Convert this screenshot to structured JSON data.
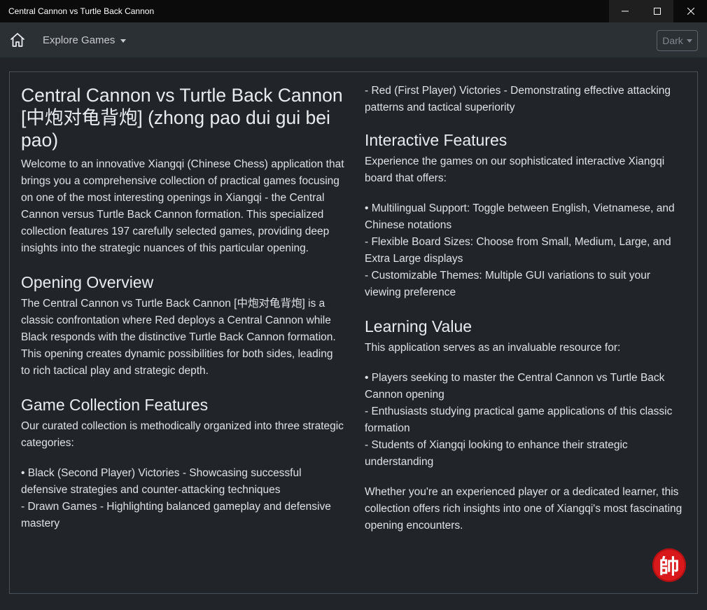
{
  "window": {
    "title": "Central Cannon vs Turtle Back Cannon",
    "minimize_icon": "minimize-icon",
    "maximize_icon": "maximize-icon",
    "close_icon": "close-icon"
  },
  "navbar": {
    "home_icon": "home-icon",
    "explore_label": "Explore Games",
    "theme_label": "Dark"
  },
  "left": {
    "title": "Central Cannon vs Turtle Back Cannon [中炮对龟背炮] (zhong pao dui gui bei pao)",
    "intro": "Welcome to an innovative Xiangqi (Chinese Chess) application that brings you a comprehensive collection of practical games focusing on one of the most interesting openings in Xiangqi - the Central Cannon versus Turtle Back Cannon formation. This specialized collection features 197 carefully selected games, providing deep insights into the strategic nuances of this particular opening.",
    "overview_heading": "Opening Overview",
    "overview_text": "The Central Cannon vs Turtle Back Cannon [中炮对龟背炮] is a classic confrontation where Red deploys a Central Cannon while Black responds with the distinctive Turtle Back Cannon formation. This opening creates dynamic possibilities for both sides, leading to rich tactical play and strategic depth.",
    "collection_heading": "Game Collection Features",
    "collection_intro": "Our curated collection is methodically organized into three strategic categories:",
    "cat_black": "• Black (Second Player) Victories - Showcasing successful defensive strategies and counter-attacking techniques",
    "cat_drawn": "- Drawn Games - Highlighting balanced gameplay and defensive mastery"
  },
  "right": {
    "cat_red": "- Red (First Player) Victories - Demonstrating effective attacking patterns and tactical superiority",
    "interactive_heading": "Interactive Features",
    "interactive_intro": "Experience the games on our sophisticated interactive Xiangqi board that offers:",
    "feat_multilingual": "• Multilingual Support: Toggle between English, Vietnamese, and Chinese notations",
    "feat_board_sizes": "- Flexible Board Sizes: Choose from Small, Medium, Large, and Extra Large displays",
    "feat_themes": "- Customizable Themes: Multiple GUI variations to suit your viewing preference",
    "learning_heading": "Learning Value",
    "learning_intro": "This application serves as an invaluable resource for:",
    "learn_players": "• Players seeking to master the Central Cannon vs Turtle Back Cannon opening",
    "learn_enthusiasts": "- Enthusiasts studying practical game applications of this classic formation",
    "learn_students": "- Students of Xiangqi looking to enhance their strategic understanding",
    "closing": "Whether you're an experienced player or a dedicated learner, this collection offers rich insights into one of Xiangqi's most fascinating opening encounters."
  },
  "badge": {
    "glyph": "帥",
    "color": "#d8181b"
  }
}
